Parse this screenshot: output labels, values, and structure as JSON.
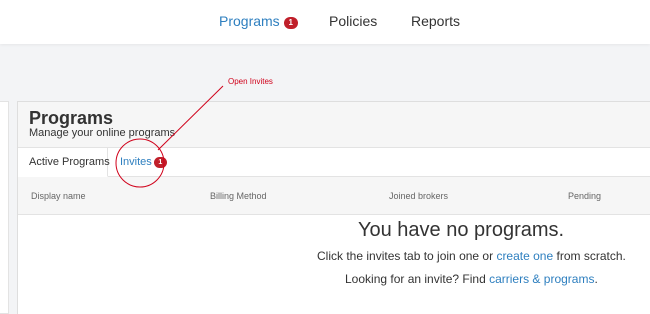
{
  "nav": {
    "items": [
      {
        "label": "Programs",
        "badge": "1"
      },
      {
        "label": "Policies"
      },
      {
        "label": "Reports"
      }
    ]
  },
  "card": {
    "title": "Programs",
    "subtitle": "Manage your online programs",
    "tabs": [
      {
        "label": "Active Programs"
      },
      {
        "label": "Invites",
        "badge": "1"
      }
    ],
    "columns": [
      "Display name",
      "Billing Method",
      "Joined brokers",
      "Pending"
    ]
  },
  "empty": {
    "title": "You have no programs.",
    "line1_prefix": "Click the invites tab to join one or ",
    "line1_link": "create one",
    "line1_suffix": " from scratch.",
    "line2_prefix": "Looking for an invite? Find ",
    "line2_link": "carriers & programs",
    "line2_suffix": "."
  },
  "annotation": {
    "label": "Open Invites",
    "color": "#d0021b"
  },
  "colors": {
    "accent": "#2e7fbf",
    "badge": "#c01f2a"
  }
}
